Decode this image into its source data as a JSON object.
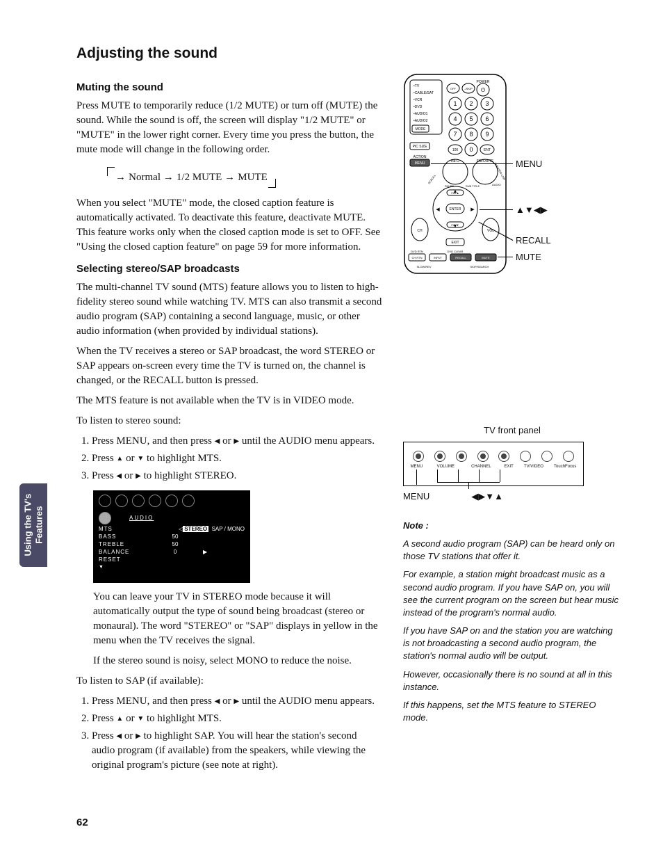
{
  "sidebar": {
    "label_line1": "Using the TV's",
    "label_line2": "Features"
  },
  "headings": {
    "h1": "Adjusting the sound",
    "h2a": "Muting the sound",
    "h2b": "Selecting stereo/SAP broadcasts"
  },
  "mute": {
    "p1": "Press MUTE to temporarily reduce (1/2 MUTE) or turn off (MUTE) the sound. While the sound is off, the screen will display \"1/2 MUTE\" or \"MUTE\" in the lower right corner. Every time you press the button, the mute mode will change in the following order.",
    "cycle_normal": "Normal",
    "cycle_half": "1/2 MUTE",
    "cycle_mute": "MUTE",
    "p2": "When you select \"MUTE\" mode, the closed caption feature is automatically activated. To deactivate this feature, deactivate MUTE. This feature works only when the closed caption mode is set to OFF. See \"Using the closed caption feature\" on page 59 for more information."
  },
  "sap": {
    "p1": "The multi-channel TV sound (MTS) feature allows you to listen to high-fidelity stereo sound while watching TV. MTS can also transmit a second audio program (SAP) containing a second language, music, or other audio information (when provided by individual stations).",
    "p2": "When the TV receives a stereo or SAP broadcast, the word STEREO or SAP appears on-screen every time the TV is turned on, the channel is changed, or the RECALL button is pressed.",
    "p3": "The MTS feature is not available when the TV is in VIDEO mode.",
    "lead1": "To listen to stereo sound:",
    "steps_stereo": {
      "s1a": "Press MENU, and then press ",
      "s1b": " or ",
      "s1c": " until the AUDIO menu appears.",
      "s2a": "Press ",
      "s2b": " or ",
      "s2c": " to highlight MTS.",
      "s3a": "Press ",
      "s3b": " or ",
      "s3c": " to highlight STEREO."
    },
    "after_osd1": "You can leave your TV in STEREO mode because it will automatically output the type of sound being broadcast (stereo or monaural). The word \"STEREO\" or \"SAP\" displays in yellow in the menu when the TV receives the signal.",
    "after_osd2": "If the stereo sound is noisy, select MONO to reduce the noise.",
    "lead2": "To listen to SAP (if available):",
    "steps_sap": {
      "s1a": "Press MENU, and then press ",
      "s1b": " or ",
      "s1c": " until the AUDIO menu appears.",
      "s2a": "Press ",
      "s2b": " or ",
      "s2c": " to highlight MTS.",
      "s3a": "Press ",
      "s3b": " or ",
      "s3c": " to highlight SAP. You will hear the station's second audio program (if available) from the speakers, while viewing the original program's picture (see note at right)."
    }
  },
  "osd": {
    "title": "AUDIO",
    "rows": [
      {
        "label": "MTS",
        "value": "",
        "opts": "STEREO   SAP / MONO",
        "badge": "STEREO"
      },
      {
        "label": "BASS",
        "value": "50"
      },
      {
        "label": "TREBLE",
        "value": "50"
      },
      {
        "label": "BALANCE",
        "value": "0"
      },
      {
        "label": "RESET",
        "value": ""
      }
    ]
  },
  "remote": {
    "callouts": {
      "menu": "MENU",
      "arrows": "▲▼◀▶",
      "recall": "RECALL",
      "mute": "MUTE"
    },
    "labels": {
      "power": "POWER",
      "tv": "TV",
      "cablesat": "CABLE/SAT",
      "vcr": "VCR",
      "dvd": "DVD",
      "audio1": "AUDIO1",
      "audio2": "AUDIO2",
      "mode": "MODE",
      "pic_size": "PIC SIZE",
      "action": "ACTION",
      "menu": "MENU",
      "info": "INFO",
      "favorite": "FAVORITE",
      "enter": "ENTER",
      "ch": "CH",
      "vol": "VOL",
      "fav_up": "FAV▲",
      "fav_dn": "FAV▼",
      "exit": "EXIT",
      "dvd_rtn": "DVD RTN",
      "ch_rtn": "CH RTN",
      "input": "INPUT",
      "recall": "RECALL",
      "mute": "MUTE",
      "dvd_clear": "DVD CLEAR",
      "slowrev": "SLOW/REV",
      "skip": "SKIP/SEARCH",
      "scroll": "SCROLL",
      "pause": "PAUSE",
      "subtitle": "SUB TITLE",
      "audio": "AUDIO",
      "theater": "THEATER LINK",
      "off_skip": "OFF",
      "skip30": "-/SKIP"
    }
  },
  "frontpanel": {
    "title": "TV front panel",
    "labels": [
      "MENU",
      "VOLUME",
      "CHANNEL",
      "EXIT",
      "TV/VIDEO",
      "TouchFocus"
    ],
    "bottom_menu": "MENU",
    "bottom_arrows": "◀▶▼▲"
  },
  "note": {
    "heading": "Note :",
    "p1": "A second audio program (SAP) can be heard only on those TV stations that offer it.",
    "p2": "For example, a station might broadcast music as a second audio program. If you have SAP on, you will see the current program on the screen but hear music instead of the program's normal audio.",
    "p3": "If you have SAP on and the station you are watching is not broadcasting a second audio program, the station's normal audio will be output.",
    "p4": "However, occasionally there is no sound at all in this instance.",
    "p5": "If this happens, set the MTS feature to STEREO mode."
  },
  "page_number": "62"
}
